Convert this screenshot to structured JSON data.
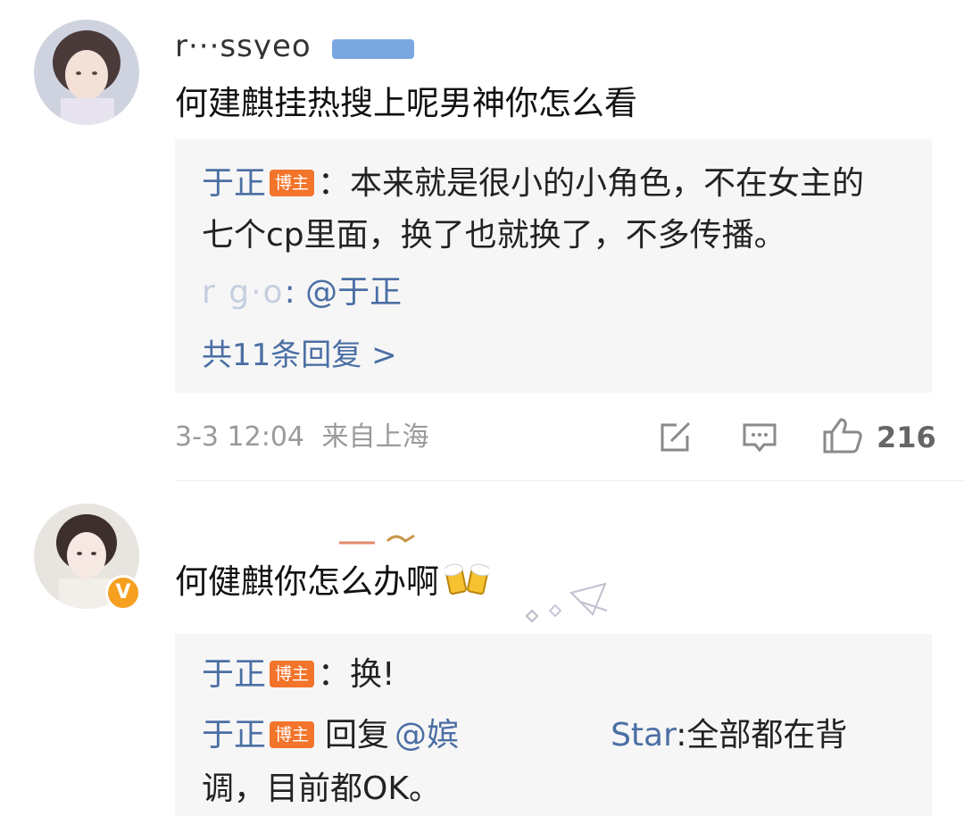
{
  "comments": [
    {
      "username": "r···ssyeo",
      "text": "何建麒挂热搜上呢男神你怎么看",
      "replies": [
        {
          "author": "于正",
          "badge": "博主",
          "sep": "：",
          "text_line1": "本来就是很小的小角色，不在女主的",
          "text_line2": "七个cp里面，换了也就换了，不多传播。"
        },
        {
          "author_blurred": "r     g·o",
          "sep": ": ",
          "mention": "@于正"
        }
      ],
      "more_replies": "共11条回复 >",
      "meta": {
        "date": "3-3 12:04",
        "location": "来自上海"
      },
      "actions": {
        "share_icon": "share-icon",
        "comment_icon": "comment-icon",
        "like_icon": "thumbs-up-icon",
        "like_count": "216"
      }
    },
    {
      "username": "",
      "text": "何健麒你怎么办啊",
      "emoji": "beer-cheers-emoji",
      "replies": [
        {
          "author": "于正",
          "badge": "博主",
          "sep": "：",
          "text": "换!"
        },
        {
          "author": "于正",
          "badge": "博主",
          "reply_word": "回复",
          "mention_prefix": "@嫔",
          "mention_suffix": "Star",
          "sep": ":",
          "text_line1": "全部都在背",
          "text_line2": "调，目前都OK。"
        }
      ]
    }
  ],
  "colors": {
    "link_blue": "#4b6fa4",
    "badge_orange": "#f3742b",
    "reply_bg": "#f6f6f6",
    "meta_gray": "#9a9a9a"
  }
}
